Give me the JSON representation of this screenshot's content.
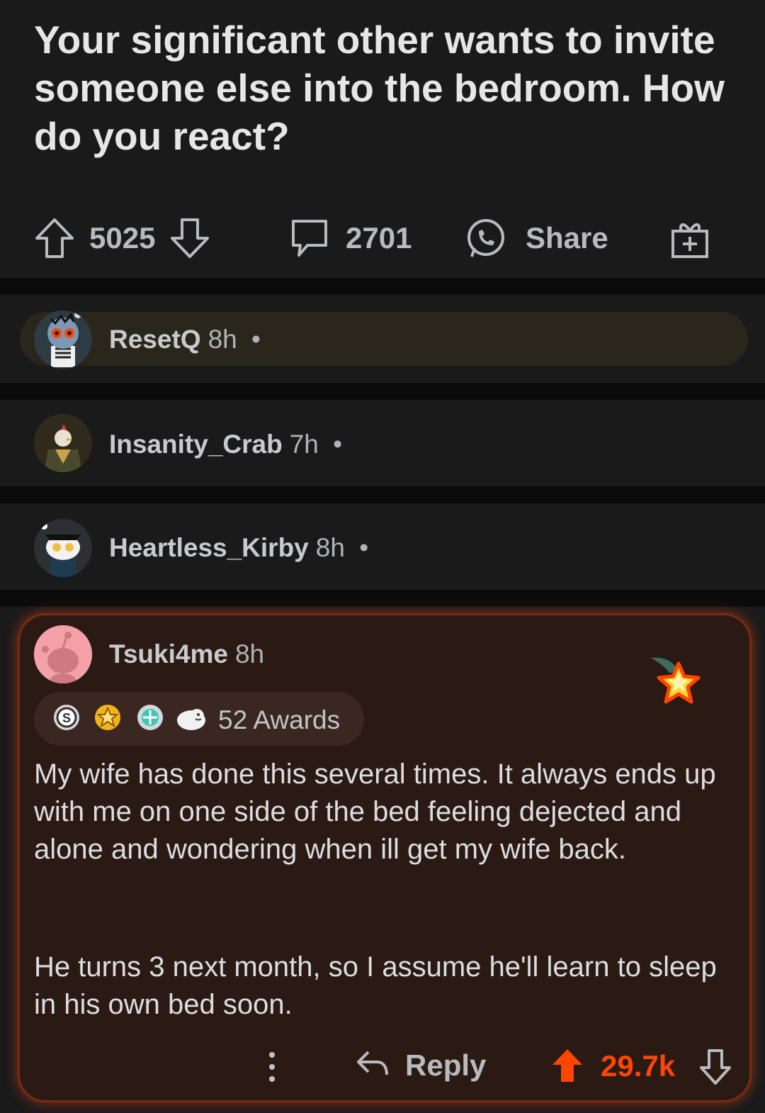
{
  "post": {
    "title": "Your significant other wants to invite someone else into the bedroom. How do you react?",
    "upvotes": "5025",
    "comments": "2701",
    "share_label": "Share"
  },
  "comments": [
    {
      "username": "ResetQ",
      "time": "8h",
      "separator": "•",
      "collapsed": true
    },
    {
      "username": "Insanity_Crab",
      "time": "7h",
      "separator": "•",
      "collapsed": true
    },
    {
      "username": "Heartless_Kirby",
      "time": "8h",
      "separator": "•",
      "collapsed": true
    }
  ],
  "highlighted": {
    "username": "Tsuki4me",
    "time": "8h",
    "awards_label": "52 Awards",
    "paragraph1": "My wife has done this several times. It always ends up with me on one side of the bed feeling dejected and alone and wondering when ill get my wife back.",
    "paragraph2": "He turns 3 next month, so I assume he'll learn to sleep in his own bed soon.",
    "reply_label": "Reply",
    "score": "29.7k"
  },
  "colors": {
    "background": "#0b0b0b",
    "card": "#1a1a1b",
    "highlight_bg": "#2b1a14",
    "upvote_orange": "#ff4500"
  }
}
